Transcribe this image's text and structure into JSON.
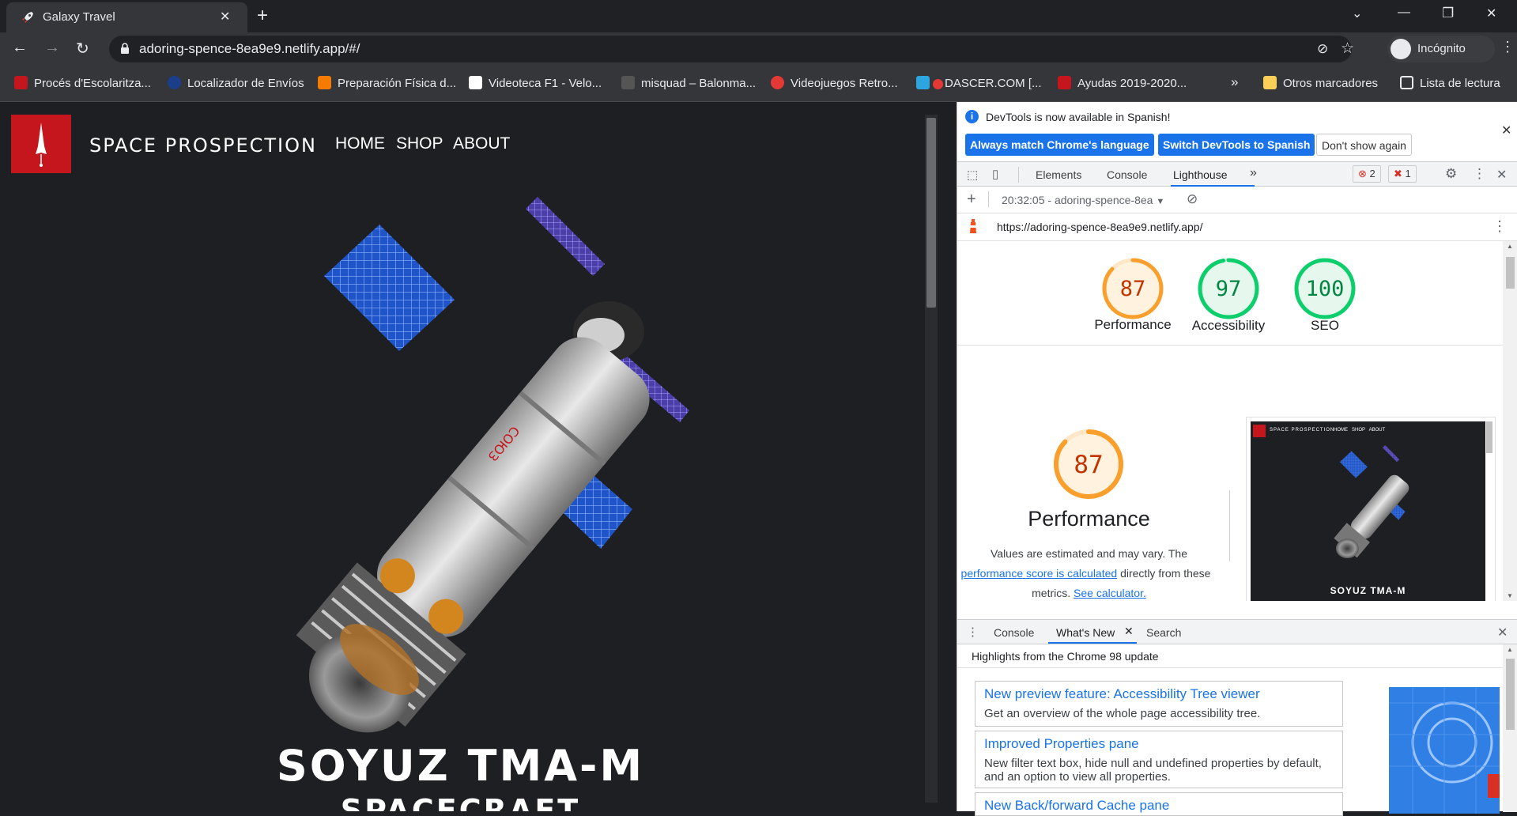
{
  "browser": {
    "tab_title": "Galaxy Travel",
    "url": "adoring-spence-8ea9e9.netlify.app/#/",
    "profile_label": "Incógnito"
  },
  "bookmarks": {
    "items": [
      {
        "label": "Procés d'Escolaritza...",
        "icon": "bookmark-favicon",
        "color": "#c4161c"
      },
      {
        "label": "Localizador de Envíos",
        "icon": "bookmark-favicon",
        "color": "#1b3e8a"
      },
      {
        "label": "Preparación Física d...",
        "icon": "blogger-icon",
        "color": "#f57c00"
      },
      {
        "label": "Videoteca F1 - Velo...",
        "icon": "bookmark-favicon",
        "color": "#ffffff"
      },
      {
        "label": "misquad – Balonma...",
        "icon": "bookmark-favicon",
        "color": "#9e9e9e"
      },
      {
        "label": "Videojuegos Retro...",
        "icon": "bookmark-favicon",
        "color": "#e53935"
      },
      {
        "label": "DASCER.COM [...",
        "icon": "telegram-icon",
        "color": "#2ca5e0"
      },
      {
        "label": "Ayudas 2019-2020...",
        "icon": "bookmark-favicon",
        "color": "#c4161c"
      }
    ],
    "more": "»",
    "other_label": "Otros marcadores",
    "reading_list_label": "Lista de lectura"
  },
  "site": {
    "brand": "SPACE PROSPECTION",
    "nav": [
      "HOME",
      "SHOP",
      "ABOUT"
    ],
    "hero_title": "SOYUZ TMA-M",
    "hero_subtitle": "SPACECRAFT",
    "accent": "#c4161c"
  },
  "devtools": {
    "info_message": "DevTools is now available in Spanish!",
    "btn_match": "Always match Chrome's language",
    "btn_switch": "Switch DevTools to Spanish",
    "btn_dont": "Don't show again",
    "tabs": [
      "Elements",
      "Console",
      "Lighthouse"
    ],
    "more_tabs": "»",
    "error_count": "2",
    "issue_count": "1",
    "report_selector": "20:32:05 - adoring-spence-8ea",
    "report_url": "https://adoring-spence-8ea9e9.netlify.app/",
    "scores": [
      {
        "value": "87",
        "label": "Performance",
        "color": "#fa9f2b",
        "fraction": 0.87
      },
      {
        "value": "97",
        "label": "Accessibility",
        "color": "#0cce6b",
        "fraction": 0.97
      },
      {
        "value": "100",
        "label": "SEO",
        "color": "#0cce6b",
        "fraction": 1.0
      }
    ],
    "perf": {
      "score": "87",
      "fraction": 0.87,
      "title": "Performance",
      "line1": "Values are estimated and may vary. The",
      "link1": "performance score is calculated",
      "line2_tail": "directly from these",
      "line3_head": "metrics.",
      "link2": "See calculator.",
      "thumb_title": "SOYUZ TMA-M",
      "thumb_brand": "SPACE PROSPECTION",
      "thumb_nav": "HOME   SHOP   ABOUT"
    },
    "drawer": {
      "tabs": [
        "Console",
        "What's New",
        "Search"
      ],
      "highlight": "Highlights from the Chrome 98 update",
      "items": [
        {
          "title": "New preview feature: Accessibility Tree viewer",
          "desc": "Get an overview of the whole page accessibility tree."
        },
        {
          "title": "Improved Properties pane",
          "desc": "New filter text box, hide null and undefined properties by default, and an option to view all properties."
        },
        {
          "title": "New Back/forward Cache pane",
          "desc": ""
        }
      ]
    }
  }
}
